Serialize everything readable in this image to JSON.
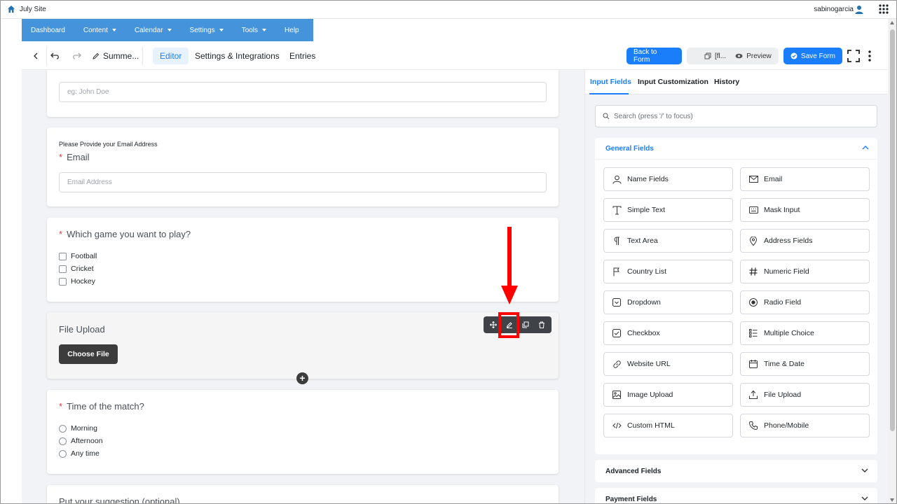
{
  "admin_bar": {
    "site_name": "July Site",
    "username": "sabinogarcia"
  },
  "nav": {
    "items": [
      {
        "label": "Dashboard",
        "has_caret": false
      },
      {
        "label": "Content",
        "has_caret": true
      },
      {
        "label": "Calendar",
        "has_caret": true
      },
      {
        "label": "Settings",
        "has_caret": true
      },
      {
        "label": "Tools",
        "has_caret": true
      },
      {
        "label": "Help",
        "has_caret": false
      }
    ],
    "color": "#4593db"
  },
  "toolbar": {
    "form_title": "Summe...",
    "tabs": [
      "Editor",
      "Settings & Integrations",
      "Entries"
    ],
    "active_tab": "Editor",
    "back_to_form": "Back to Form",
    "shortcode": "[fl...",
    "preview": "Preview",
    "save_form": "Save Form"
  },
  "form": {
    "name_placeholder": "eg: John Doe",
    "email": {
      "help": "Please Provide your Email Address",
      "label": "Email",
      "placeholder": "Email Address"
    },
    "game": {
      "label": "Which game you want to play?",
      "options": [
        "Football",
        "Cricket",
        "Hockey"
      ]
    },
    "file_upload": {
      "label": "File Upload",
      "button": "Choose File"
    },
    "time": {
      "label": "Time of the match?",
      "options": [
        "Morning",
        "Afternoon",
        "Any time"
      ]
    },
    "next_label": "Put your suggestion (optional)"
  },
  "panel": {
    "tabs": [
      "Input Fields",
      "Input Customization",
      "History"
    ],
    "active_tab": "Input Fields",
    "search_placeholder": "Search (press '/' to focus)",
    "general_title": "General Fields",
    "fields": [
      {
        "label": "Name Fields",
        "icon": "user-icon"
      },
      {
        "label": "Email",
        "icon": "envelope-icon"
      },
      {
        "label": "Simple Text",
        "icon": "text-icon"
      },
      {
        "label": "Mask Input",
        "icon": "keyboard-icon"
      },
      {
        "label": "Text Area",
        "icon": "paragraph-icon"
      },
      {
        "label": "Address Fields",
        "icon": "map-pin-icon"
      },
      {
        "label": "Country List",
        "icon": "flag-icon"
      },
      {
        "label": "Numeric Field",
        "icon": "hash-icon"
      },
      {
        "label": "Dropdown",
        "icon": "dropdown-icon"
      },
      {
        "label": "Radio Field",
        "icon": "radio-icon"
      },
      {
        "label": "Checkbox",
        "icon": "checkbox-icon"
      },
      {
        "label": "Multiple Choice",
        "icon": "list-icon"
      },
      {
        "label": "Website URL",
        "icon": "link-icon"
      },
      {
        "label": "Time & Date",
        "icon": "calendar-icon"
      },
      {
        "label": "Image Upload",
        "icon": "image-icon"
      },
      {
        "label": "File Upload",
        "icon": "upload-icon"
      },
      {
        "label": "Custom HTML",
        "icon": "code-icon"
      },
      {
        "label": "Phone/Mobile",
        "icon": "phone-icon"
      }
    ],
    "advanced_title": "Advanced Fields",
    "payment_title": "Payment Fields"
  },
  "colors": {
    "accent": "#1a7efb",
    "annotation": "#ff0000"
  }
}
